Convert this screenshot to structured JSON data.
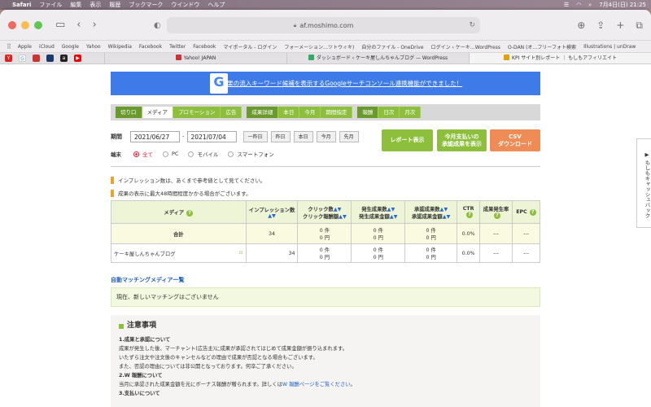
{
  "menubar": {
    "app": "Safari",
    "items": [
      "ファイル",
      "編集",
      "表示",
      "履歴",
      "ブックマーク",
      "ウインドウ",
      "ヘルプ"
    ],
    "clock": "7月4日(日)  21:25"
  },
  "browser": {
    "url": "af.moshimo.com",
    "favorites": [
      "Apple",
      "iCloud",
      "Google",
      "Yahoo",
      "Wikipedia",
      "Facebook",
      "Twitter",
      "Facebook",
      "マイポータル - ログイン",
      "フォーメーション…ツトウィキ)",
      "自分のファイル - OneDrive",
      "ログイン ‹ ケーキ…WordPress",
      "O-DAN (オ…フリーフォト検索",
      "Illustrations | unDraw"
    ],
    "tabs": [
      "Yahoo! JAPAN",
      "ダッシュボード ‹ ケーキ屋しんちゃんブログ — WordPress",
      "KPI サイト別レポート ｜ もしもアフィリエイト"
    ]
  },
  "banner": {
    "text": "成果の流入キーワード候補を表示するGoogleサーチコンソール連携機能ができました！",
    "logo": "G"
  },
  "filters": {
    "group1": [
      "切り口",
      "メディア",
      "プロモーション",
      "広告"
    ],
    "group2": [
      "成果詳細",
      "本日",
      "今月",
      "期間指定"
    ],
    "group3": [
      "報酬",
      "日次",
      "月次"
    ]
  },
  "period": {
    "label": "期間",
    "from": "2021/06/27",
    "to": "2021/07/04",
    "sep": "-",
    "buttons": [
      "一昨日",
      "昨日",
      "本日",
      "今月",
      "先月"
    ]
  },
  "terminal": {
    "label": "端末",
    "options": [
      "全て",
      "PC",
      "モバイル",
      "スマートフォン"
    ]
  },
  "actions": {
    "report": "レポート表示",
    "approved_l1": "今月支払いの",
    "approved_l2": "承認成果を表示",
    "csv_l1": "CSV",
    "csv_l2": "ダウンロード"
  },
  "notices": [
    "インプレッション数は、あくまで参考値として見てください。",
    "成果の表示に最大48時間程度かかる場合がございます。"
  ],
  "table": {
    "headers": {
      "media": "メディア",
      "impressions": "インプレッション数",
      "clicks_l1": "クリック数",
      "clicks_l2": "クリック報酬額",
      "gen_l1": "発生成果数",
      "gen_l2": "発生成果金額",
      "appr_l1": "承認成果数",
      "appr_l2": "承認成果金額",
      "ctr": "CTR",
      "rate": "成果発生率",
      "epc": "EPC",
      "arrows": "▲▼"
    },
    "total": {
      "label": "合計",
      "impressions": "34",
      "c1": "0 件",
      "c2": "0 円",
      "g1": "0 件",
      "g2": "0 円",
      "a1": "0 件",
      "a2": "0 円",
      "ctr": "0.0%",
      "rate": "---",
      "epc": "---"
    },
    "rows": [
      {
        "media": "ケーキ屋しんちゃんブログ",
        "impressions": "34",
        "c1": "0 件",
        "c2": "0 円",
        "g1": "0 件",
        "g2": "0 円",
        "a1": "0 件",
        "a2": "0 円",
        "ctr": "0.0%",
        "rate": "---",
        "epc": "---"
      }
    ]
  },
  "auto_matching": {
    "title": "自動マッチングメディア一覧",
    "message": "現在、新しいマッチングはございません"
  },
  "caution": {
    "title": "注意事項",
    "s1_title": "1.成果と承認について",
    "s1_l1": "成果が発生した後、マーチャント(広告主)に成果が承認されてはじめて成果金額が振り込まれます。",
    "s1_l2": "いたずら注文や注文後のキャンセルなどの理由で成果が否認となる場合もございます。",
    "s1_l3": "また、否認の理由については非公開となっております。何卒ご了承ください。",
    "s2_title": "2.W 報酬について",
    "s2_l1": "当月に承認された成果金額を元にボーナス報酬が贈られます。詳しくは",
    "s2_link": "W 報酬ページをご覧ください",
    "s2_end": "。",
    "s3_title": "3.支払いについて"
  },
  "sidetab": "もしもキャッシュバック"
}
